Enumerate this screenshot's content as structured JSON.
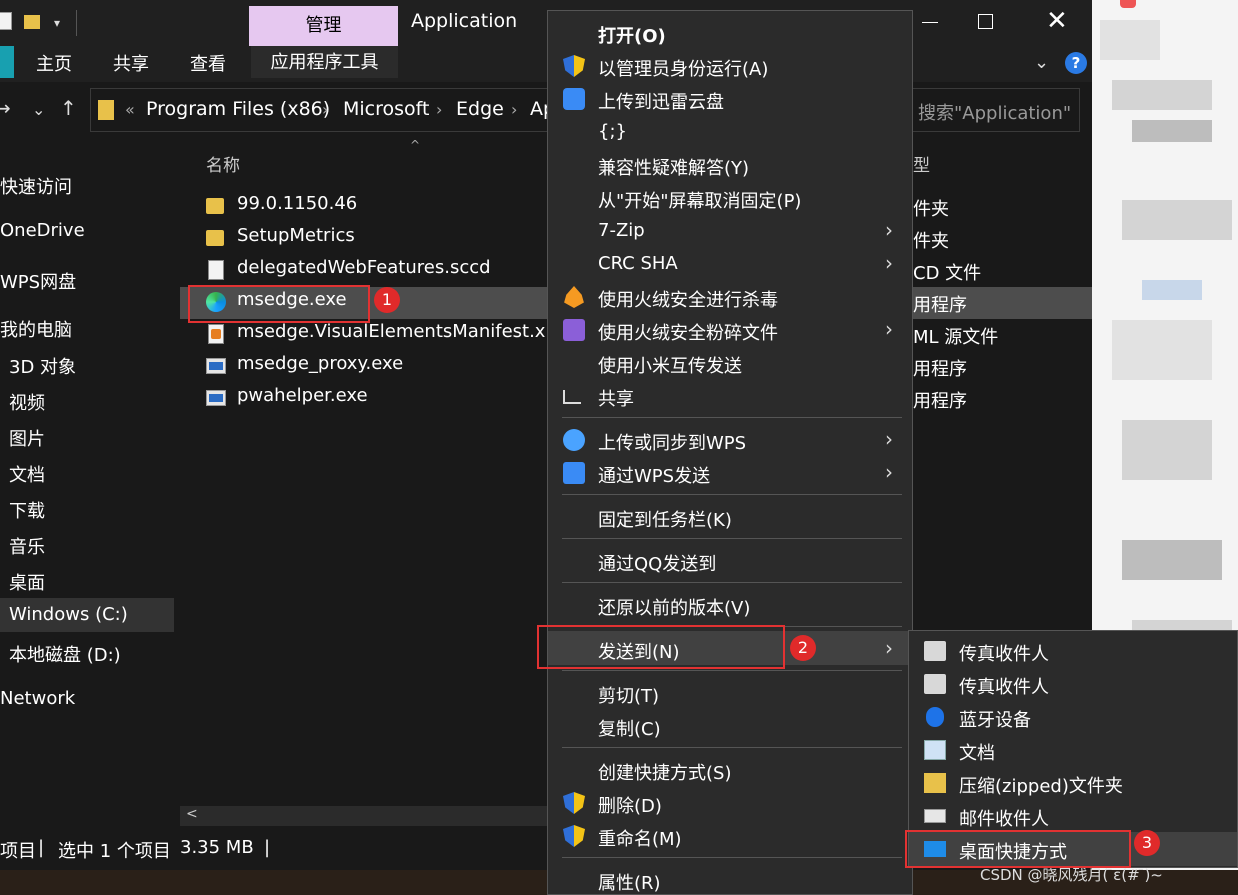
{
  "window": {
    "title": "Application",
    "manage_tab": "管理",
    "close_glyph": "✕",
    "quick_access_dropdown": "▾"
  },
  "ribbon": {
    "tabs": [
      "主页",
      "共享",
      "查看",
      "应用程序工具"
    ],
    "collapse_glyph": "⌄",
    "help_glyph": "?"
  },
  "navigation": {
    "back": "→",
    "recent": "⌄",
    "up": "↑",
    "breadcrumb_overflow": "«",
    "breadcrumbs": [
      "Program Files (x86)",
      "Microsoft",
      "Edge",
      "Ap"
    ],
    "separator": "›",
    "search_placeholder": "搜索\"Application\""
  },
  "sidebar": {
    "items": [
      "快速访问",
      "OneDrive",
      "WPS网盘",
      "我的电脑",
      "3D 对象",
      "视频",
      "图片",
      "文档",
      "下载",
      "音乐",
      "桌面",
      "Windows (C:)",
      "本地磁盘 (D:)",
      "Network"
    ]
  },
  "file_list": {
    "col_name": "名称",
    "col_type": "型",
    "sort_glyph": "^",
    "files": [
      {
        "name": "99.0.1150.46",
        "type": "件夹",
        "icon": "folder-icon"
      },
      {
        "name": "SetupMetrics",
        "type": "件夹",
        "icon": "folder-icon"
      },
      {
        "name": "delegatedWebFeatures.sccd",
        "type": "CD 文件",
        "icon": "document-icon"
      },
      {
        "name": "msedge.exe",
        "type": "用程序",
        "icon": "edge-icon"
      },
      {
        "name": "msedge.VisualElementsManifest.xml",
        "type": "ML 源文件",
        "icon": "xml-icon"
      },
      {
        "name": "msedge_proxy.exe",
        "type": "用程序",
        "icon": "exe-icon"
      },
      {
        "name": "pwahelper.exe",
        "type": "用程序",
        "icon": "exe-icon"
      }
    ],
    "scroll_left": "<"
  },
  "status": {
    "count_suffix": "项目",
    "sep": "|",
    "selected": "选中 1 个项目",
    "size": "3.35 MB"
  },
  "context_menu": {
    "items": [
      {
        "label": "打开(O)"
      },
      {
        "label": "以管理员身份运行(A)"
      },
      {
        "label": "上传到迅雷云盘"
      },
      {
        "label": "{;}"
      },
      {
        "label": "兼容性疑难解答(Y)"
      },
      {
        "label": "从\"开始\"屏幕取消固定(P)"
      },
      {
        "label": "7-Zip"
      },
      {
        "label": "CRC SHA"
      },
      {
        "label": "使用火绒安全进行杀毒"
      },
      {
        "label": "使用火绒安全粉碎文件"
      },
      {
        "label": "使用小米互传发送"
      },
      {
        "label": "共享"
      },
      {
        "label": "上传或同步到WPS"
      },
      {
        "label": "通过WPS发送"
      },
      {
        "label": "固定到任务栏(K)"
      },
      {
        "label": "通过QQ发送到"
      },
      {
        "label": "还原以前的版本(V)"
      },
      {
        "label": "发送到(N)"
      },
      {
        "label": "剪切(T)"
      },
      {
        "label": "复制(C)"
      },
      {
        "label": "创建快捷方式(S)"
      },
      {
        "label": "删除(D)"
      },
      {
        "label": "重命名(M)"
      },
      {
        "label": "属性(R)"
      }
    ],
    "arrow": "›"
  },
  "send_to_menu": {
    "items": [
      "传真收件人",
      "传真收件人",
      "蓝牙设备",
      "文档",
      "压缩(zipped)文件夹",
      "邮件收件人",
      "桌面快捷方式"
    ]
  },
  "annotations": [
    "1",
    "2",
    "3"
  ],
  "overlay": {
    "watermark": "CSDN @晓风残月( ̄ε(# ̄)~"
  },
  "colors": {
    "accent_red": "#e02a2a",
    "manage_tab": "#e6c8f0",
    "menu_bg": "#2b2b2b",
    "window_bg": "#191919"
  }
}
